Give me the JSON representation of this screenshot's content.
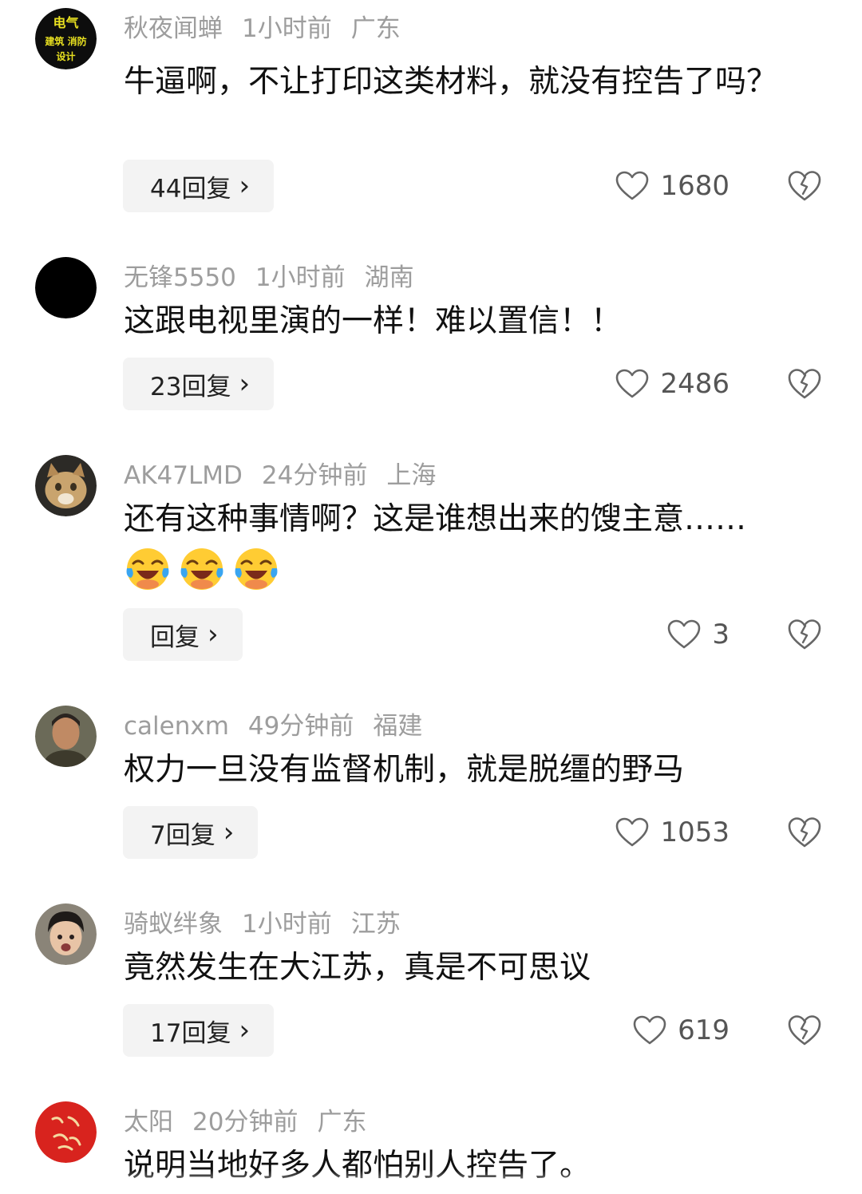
{
  "comments": [
    {
      "user": "秋夜闻蝉",
      "time": "1小时前",
      "location": "广东",
      "text": "牛逼啊，不让打印这类材料，就没有控告了吗？",
      "replies": "44回复",
      "likes": "1680",
      "avatar_text": [
        "电气",
        "建筑 消防",
        "设计"
      ]
    },
    {
      "user": "无锋5550",
      "time": "1小时前",
      "location": "湖南",
      "text": "这跟电视里演的一样！难以置信！！",
      "replies": "23回复",
      "likes": "2486"
    },
    {
      "user": "AK47LMD",
      "time": "24分钟前",
      "location": "上海",
      "text": "还有这种事情啊？这是谁想出来的馊主意……",
      "emojis": [
        "laughing-crying-emoji",
        "laughing-crying-emoji",
        "laughing-crying-emoji"
      ],
      "replies": "回复",
      "likes": "3"
    },
    {
      "user": "calenxm",
      "time": "49分钟前",
      "location": "福建",
      "text": "权力一旦没有监督机制，就是脱缰的野马",
      "replies": "7回复",
      "likes": "1053"
    },
    {
      "user": "骑蚁绊象",
      "time": "1小时前",
      "location": "江苏",
      "text": "竟然发生在大江苏，真是不可思议",
      "replies": "17回复",
      "likes": "619"
    },
    {
      "user": "太阳",
      "time": "20分钟前",
      "location": "广东",
      "text": "说明当地好多人都怕别人控告了。"
    }
  ],
  "icons": {
    "reply_chevron": "›",
    "like": "heart-outline-icon",
    "dislike": "broken-heart-icon"
  },
  "colors": {
    "meta_text": "#9d9d9d",
    "body_text": "#111111",
    "reply_bg": "#f3f3f3",
    "icon_stroke": "#666666"
  }
}
